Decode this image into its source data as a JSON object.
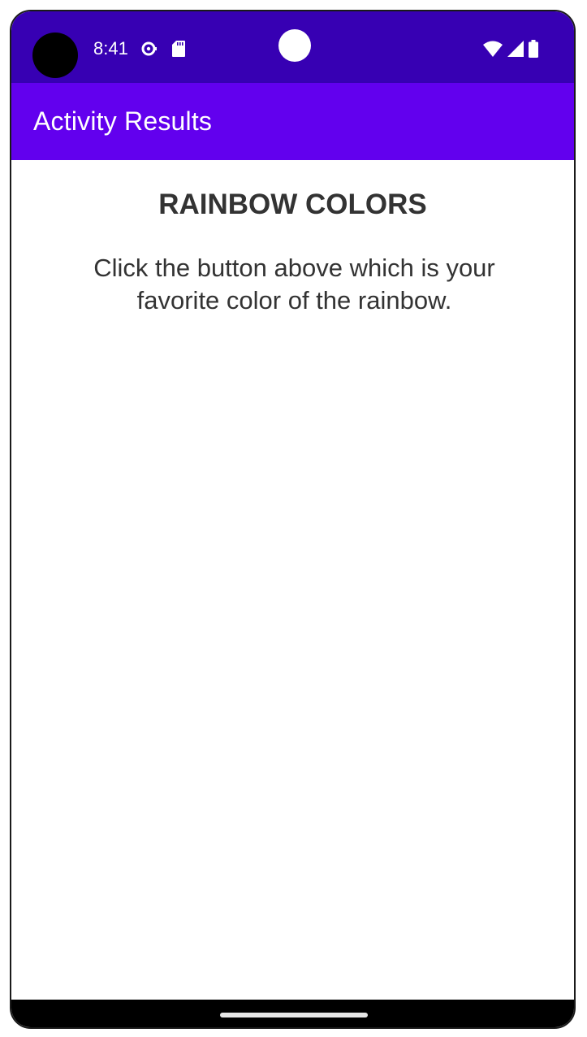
{
  "status_bar": {
    "time": "8:41",
    "background_color": "#3700b3",
    "left_icons": [
      "sync-icon",
      "sd-card-icon"
    ],
    "right_icons": [
      "wifi-icon",
      "cell-signal-icon",
      "battery-icon"
    ]
  },
  "app_bar": {
    "title": "Activity Results",
    "background_color": "#6200ee"
  },
  "main": {
    "heading": "RAINBOW COLORS",
    "instructions": "Click the button above which is your favorite color of the rainbow."
  }
}
